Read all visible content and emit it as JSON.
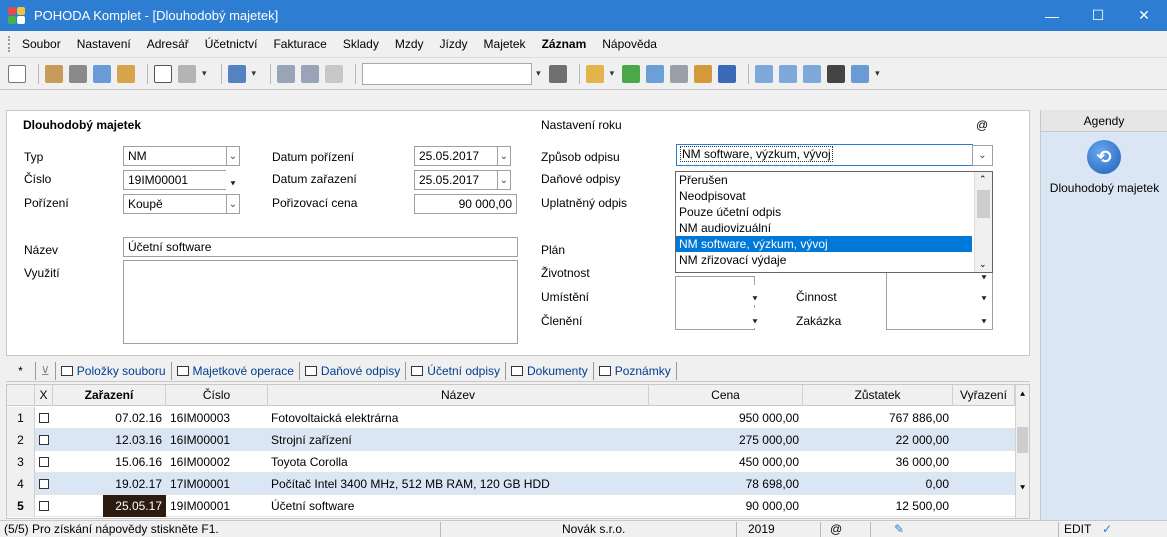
{
  "window": {
    "title": "POHODA Komplet - [Dlouhodobý majetek]",
    "controls": [
      "—",
      "☐",
      "✕"
    ]
  },
  "menu": {
    "items": [
      "Soubor",
      "Nastavení",
      "Adresář",
      "Účetnictví",
      "Fakturace",
      "Sklady",
      "Mzdy",
      "Jízdy",
      "Majetek",
      "Záznam",
      "Nápověda"
    ]
  },
  "form": {
    "section_left": "Dlouhodobý majetek",
    "section_right": "Nastavení roku",
    "at_symbol": "@",
    "typ_label": "Typ",
    "typ_value": "NM",
    "cislo_label": "Číslo",
    "cislo_value": "19IM00001",
    "porizeni_label": "Pořízení",
    "porizeni_value": "Koupě",
    "datum_porizeni_label": "Datum pořízení",
    "datum_porizeni_value": "25.05.2017",
    "datum_zarazeni_label": "Datum zařazení",
    "datum_zarazeni_value": "25.05.2017",
    "porizovaci_cena_label": "Pořizovací cena",
    "porizovaci_cena_value": "90 000,00",
    "nazev_label": "Název",
    "nazev_value": "Účetní software",
    "vyuziti_label": "Využití",
    "zpusob_odpisu_label": "Způsob odpisu",
    "zpusob_odpisu_value": "NM software, výzkum, vývoj",
    "danove_odpisy_label": "Daňové odpisy",
    "uplatneny_odpis_label": "Uplatněný odpis",
    "plan_label": "Plán",
    "zivotnost_label": "Životnost",
    "umisteni_label": "Umístění",
    "cleneni_label": "Členění",
    "cinnost_label": "Činnost",
    "zakazka_label": "Zakázka"
  },
  "dropdown_options": [
    "Přerušen",
    "Neodpisovat",
    "Pouze účetní odpis",
    "NM audiovizuální",
    "NM software, výzkum, vývoj",
    "NM zřizovací výdaje"
  ],
  "agendy": {
    "header": "Agendy",
    "item_label": "Dlouhodobý majetek"
  },
  "tabs": [
    "Položky souboru",
    "Majetkové operace",
    "Daňové odpisy",
    "Účetní odpisy",
    "Dokumenty",
    "Poznámky"
  ],
  "tabs_first": "*",
  "table": {
    "headers": [
      "X",
      "Zařazení",
      "Číslo",
      "Název",
      "Cena",
      "Zůstatek",
      "Vyřazení"
    ],
    "rows": [
      {
        "n": "1",
        "date": "07.02.16",
        "cislo": "16IM00003",
        "nazev": "Fotovoltaická elektrárna",
        "cena": "950 000,00",
        "zustatek": "767 886,00"
      },
      {
        "n": "2",
        "date": "12.03.16",
        "cislo": "16IM00001",
        "nazev": "Strojní zařízení",
        "cena": "275 000,00",
        "zustatek": "22 000,00"
      },
      {
        "n": "3",
        "date": "15.06.16",
        "cislo": "16IM00002",
        "nazev": "Toyota Corolla",
        "cena": "450 000,00",
        "zustatek": "36 000,00"
      },
      {
        "n": "4",
        "date": "19.02.17",
        "cislo": "17IM00001",
        "nazev": "Počítač Intel 3400 MHz, 512 MB RAM, 120 GB HDD",
        "cena": "78 698,00",
        "zustatek": "0,00"
      },
      {
        "n": "5",
        "date": "25.05.17",
        "cislo": "19IM00001",
        "nazev": "Účetní software",
        "cena": "90 000,00",
        "zustatek": "12 500,00"
      }
    ]
  },
  "status": {
    "help": "(5/5) Pro získání nápovědy stiskněte F1.",
    "company": "Novák s.r.o.",
    "year": "2019",
    "at": "@",
    "mode": "EDIT"
  },
  "colors": {
    "titlebar": "#2d7dd2",
    "selection": "#0078d7",
    "row_alt": "#dbe6f4"
  }
}
